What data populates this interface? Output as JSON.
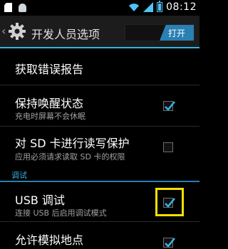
{
  "status_bar": {
    "time": "08:12",
    "icons": [
      "sd-card-icon",
      "android-icon",
      "wifi-icon",
      "signal-icon",
      "battery-icon"
    ]
  },
  "action_bar": {
    "title": "开发人员选项",
    "toggle_label": "打开",
    "accent_color": "#33b5e5"
  },
  "items": [
    {
      "title": "获取错误报告",
      "summary": "",
      "checked": null
    },
    {
      "title": "保持唤醒状态",
      "summary": "充电时屏幕不会休眠",
      "checked": true
    },
    {
      "title": "对 SD 卡进行读写保护",
      "summary": "应用必须请求读取 SD 卡的权限",
      "checked": false
    }
  ],
  "section": {
    "label": "调试"
  },
  "debug_items": [
    {
      "title": "USB 调试",
      "summary": "连接 USB 后启用调试模式",
      "checked": true
    },
    {
      "title": "允许模拟地点",
      "summary": "",
      "checked": true
    }
  ],
  "highlight_color": "#f5e000"
}
